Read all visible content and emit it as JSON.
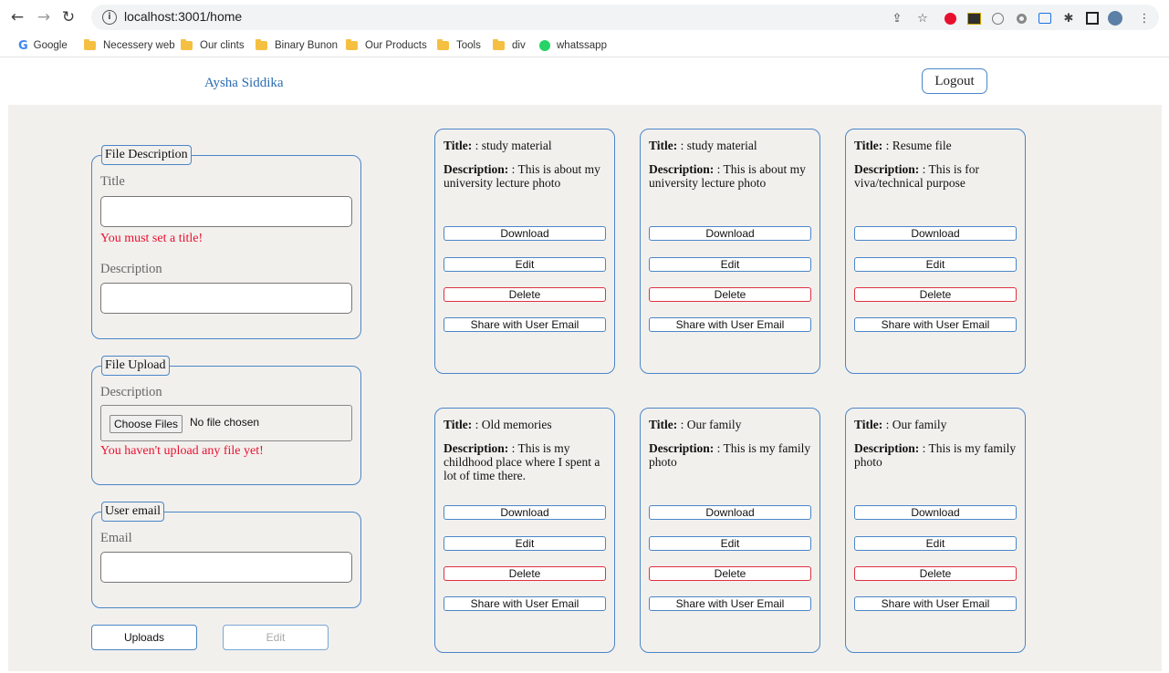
{
  "browser": {
    "url": "localhost:3001/home",
    "bookmarks": [
      "Google",
      "Necessery web",
      "Our clints",
      "Binary Bunon",
      "Our Products",
      "Tools",
      "div",
      "whatssapp"
    ]
  },
  "header": {
    "user_name": "Aysha Siddika",
    "logout_label": "Logout"
  },
  "form": {
    "file_description": {
      "legend": "File Description",
      "title_label": "Title",
      "title_error": "You must set a title!",
      "description_label": "Description"
    },
    "file_upload": {
      "legend": "File Upload",
      "description_label": "Description",
      "choose_label": "Choose Files",
      "no_file_label": "No file chosen",
      "error": "You haven't upload any file yet!"
    },
    "user_email": {
      "legend": "User email",
      "email_label": "Email"
    },
    "uploads_label": "Uploads",
    "edit_label": "Edit"
  },
  "card_labels": {
    "title": "Title:",
    "description": "Description:",
    "download": "Download",
    "edit": "Edit",
    "delete": "Delete",
    "share": "Share with User Email"
  },
  "cards": [
    {
      "title": ": study material",
      "description": ": This is about my university lecture photo"
    },
    {
      "title": ": study material",
      "description": ": This is about my university lecture photo"
    },
    {
      "title": ": Resume file",
      "description": ": This is for viva/technical purpose"
    },
    {
      "title": ": Old memories",
      "description": ": This is my childhood place where I spent a lot of time there."
    },
    {
      "title": ": Our family",
      "description": ": This is my family photo"
    },
    {
      "title": ": Our family",
      "description": ": This is my family photo"
    }
  ]
}
